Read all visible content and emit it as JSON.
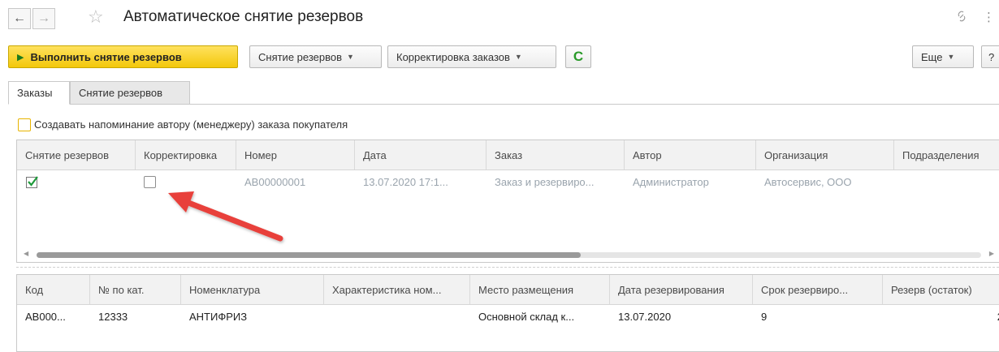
{
  "header": {
    "title": "Автоматическое снятие резервов",
    "back_glyph": "←",
    "forward_glyph": "→",
    "star_glyph": "☆",
    "link_glyph": "🔗",
    "more_glyph": "⋮"
  },
  "toolbar": {
    "run_label": "Выполнить снятие резервов",
    "remove_reserves_label": "Снятие резервов",
    "correct_orders_label": "Корректировка заказов",
    "refresh_glyph": "C",
    "more_label": "Еще",
    "help_label": "?"
  },
  "tabs": [
    {
      "label": "Заказы",
      "active": true
    },
    {
      "label": "Снятие резервов",
      "active": false
    }
  ],
  "reminder": {
    "label": "Создавать напоминание автору (менеджеру) заказа покупателя",
    "checked": false
  },
  "orders_table": {
    "headers": [
      "Снятие резервов",
      "Корректировка",
      "Номер",
      "Дата",
      "Заказ",
      "Автор",
      "Организация",
      "Подразделения"
    ],
    "rows": [
      {
        "remove_reserve": true,
        "correction": false,
        "number": "АВ00000001",
        "date": "13.07.2020 17:1...",
        "order": "Заказ и резервиро...",
        "author": "Администратор",
        "organization": "Автосервис, ООО",
        "department": ""
      }
    ]
  },
  "items_table": {
    "headers": [
      "Код",
      "№ по кат.",
      "Номенклатура",
      "Характеристика ном...",
      "Место размещения",
      "Дата резервирования",
      "Срок резервиро...",
      "Резерв (остаток)"
    ],
    "rows": [
      {
        "code": "АВ000...",
        "cat_no": "12333",
        "nomenclature": "АНТИФРИЗ",
        "characteristic": "",
        "location": "Основной склад к...",
        "reserve_date": "13.07.2020",
        "reserve_term": "9",
        "reserve_balance": "2"
      }
    ]
  },
  "colors": {
    "primary_button": "#f3c80b",
    "check_green": "#1d9a3a",
    "arrow_red": "#e8413a"
  }
}
